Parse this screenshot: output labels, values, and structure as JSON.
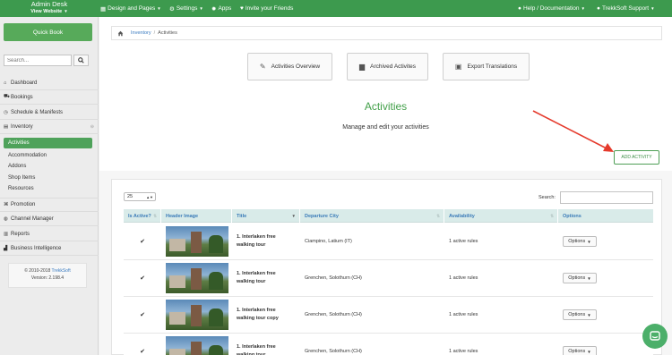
{
  "topbar": {
    "app_title": "Admin Desk",
    "view_website": "View Website",
    "menu": [
      {
        "icon": "grid-icon",
        "label": "Design and Pages"
      },
      {
        "icon": "gear-icon",
        "label": "Settings"
      },
      {
        "icon": "apps-icon",
        "label": "Apps"
      },
      {
        "icon": "heart-icon",
        "label": "Invite your Friends"
      }
    ],
    "help": "Help / Documentation",
    "user": "TrekkSoft Support"
  },
  "sidebar": {
    "quick_book": "Quick Book",
    "search_placeholder": "Search...",
    "items": [
      {
        "label": "Dashboard",
        "icon": "home-icon"
      },
      {
        "label": "Bookings",
        "icon": "cart-icon"
      },
      {
        "label": "Schedule & Manifests",
        "icon": "clock-icon"
      },
      {
        "label": "Inventory",
        "icon": "list-icon"
      }
    ],
    "sub_items": [
      "Activities",
      "Accommodation",
      "Addons",
      "Shop Items",
      "Resources"
    ],
    "items2": [
      {
        "label": "Promotion",
        "icon": "tag-icon"
      },
      {
        "label": "Channel Manager",
        "icon": "globe-icon"
      },
      {
        "label": "Reports",
        "icon": "report-icon"
      },
      {
        "label": "Business Intelligence",
        "icon": "chart-icon"
      }
    ],
    "copyright": "© 2010-2018",
    "copyright_link": "TrekkSoft",
    "version": "Version: 2.198.4"
  },
  "breadcrumb": {
    "section": "Inventory",
    "current": "Activities"
  },
  "toolbar": {
    "overview": "Activities Overview",
    "archived": "Archived Activites",
    "export": "Export Translations"
  },
  "page": {
    "title": "Activities",
    "subtitle": "Manage and edit your activities",
    "add_button": "ADD ACTIVITY"
  },
  "table": {
    "page_length": "25",
    "search_label": "Search:",
    "columns": [
      "Is Active?",
      "Header Image",
      "Title",
      "Departure City",
      "Availability",
      "Options"
    ],
    "rows": [
      {
        "active": "✔",
        "title": "1. Interlaken free walking tour",
        "city": "Ciampino, Latium (IT)",
        "availability": "1 active rules",
        "options": "Options"
      },
      {
        "active": "✔",
        "title": "1. Interlaken free walking tour",
        "city": "Grenchen, Solothurn (CH)",
        "availability": "1 active rules",
        "options": "Options"
      },
      {
        "active": "✔",
        "title": "1. Interlaken free walking tour copy",
        "city": "Grenchen, Solothurn (CH)",
        "availability": "1 active rules",
        "options": "Options"
      },
      {
        "active": "✔",
        "title": "1. Interlaken free walking tour",
        "city": "Grenchen, Solothurn (CH)",
        "availability": "1 active rules",
        "options": "Options"
      }
    ]
  },
  "colors": {
    "brand": "#3d9a4e",
    "accent": "#43a04a",
    "arrow": "#e53a2c"
  }
}
